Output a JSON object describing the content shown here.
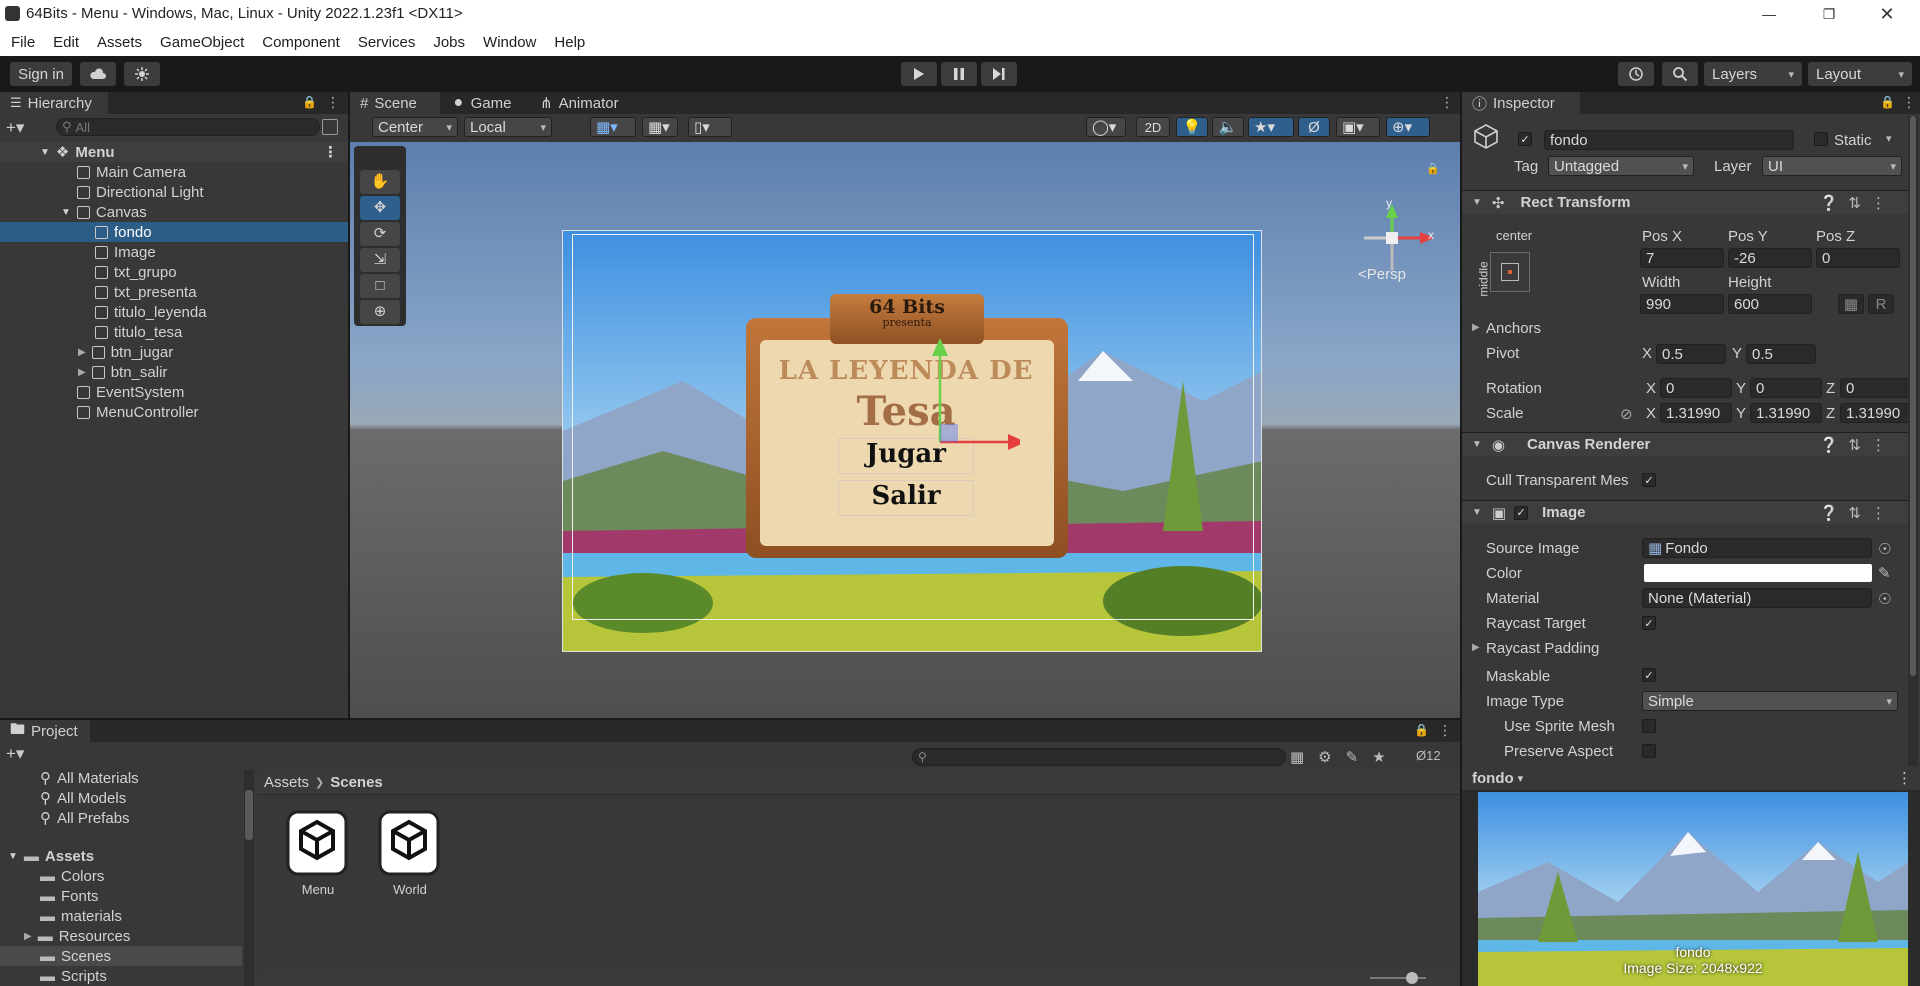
{
  "window": {
    "title": "64Bits - Menu - Windows, Mac, Linux - Unity 2022.1.23f1 <DX11>"
  },
  "menu": [
    "File",
    "Edit",
    "Assets",
    "GameObject",
    "Component",
    "Services",
    "Jobs",
    "Window",
    "Help"
  ],
  "toolbar": {
    "sign_in": "Sign in",
    "layers": "Layers",
    "layout": "Layout"
  },
  "hierarchy": {
    "tab": "Hierarchy",
    "search_placeholder": "All",
    "items": [
      {
        "label": "Menu",
        "depth": 0,
        "kind": "scene",
        "expanded": true
      },
      {
        "label": "Main Camera",
        "depth": 1
      },
      {
        "label": "Directional Light",
        "depth": 1
      },
      {
        "label": "Canvas",
        "depth": 1,
        "expanded": true
      },
      {
        "label": "fondo",
        "depth": 2,
        "selected": true
      },
      {
        "label": "Image",
        "depth": 2
      },
      {
        "label": "txt_grupo",
        "depth": 2
      },
      {
        "label": "txt_presenta",
        "depth": 2
      },
      {
        "label": "titulo_leyenda",
        "depth": 2
      },
      {
        "label": "titulo_tesa",
        "depth": 2
      },
      {
        "label": "btn_jugar",
        "depth": 2,
        "collapsed": true
      },
      {
        "label": "btn_salir",
        "depth": 2,
        "collapsed": true
      },
      {
        "label": "EventSystem",
        "depth": 1
      },
      {
        "label": "MenuController",
        "depth": 1
      }
    ]
  },
  "scene": {
    "tabs": [
      "Scene",
      "Game",
      "Animator"
    ],
    "pivot_mode": "Center",
    "pivot_space": "Local",
    "mode_2d": "2D",
    "persp": "<Persp",
    "gizmo_y": "y",
    "gizmo_x": "x",
    "sign": {
      "title": "64 Bits",
      "subtitle": "presenta",
      "line1": "LA LEYENDA DE",
      "line2": "Tesa",
      "btn1": "Jugar",
      "btn2": "Salir"
    }
  },
  "inspector": {
    "tab": "Inspector",
    "object_name": "fondo",
    "static_label": "Static",
    "tag_label": "Tag",
    "tag_value": "Untagged",
    "layer_label": "Layer",
    "layer_value": "UI",
    "rect": {
      "header": "Rect Transform",
      "anchor_h": "center",
      "anchor_v": "middle",
      "pos_x_label": "Pos X",
      "pos_y_label": "Pos Y",
      "pos_z_label": "Pos Z",
      "pos_x": "7",
      "pos_y": "-26",
      "pos_z": "0",
      "width_label": "Width",
      "height_label": "Height",
      "width": "990",
      "height": "600",
      "r_btn": "R",
      "anchors": "Anchors",
      "pivot": "Pivot",
      "pivot_x": "0.5",
      "pivot_y": "0.5",
      "rotation": "Rotation",
      "rot_x": "0",
      "rot_y": "0",
      "rot_z": "0",
      "scale": "Scale",
      "scale_x": "1.31990",
      "scale_y": "1.31990",
      "scale_z": "1.31990",
      "x": "X",
      "y": "Y",
      "z": "Z"
    },
    "canvas_renderer": {
      "header": "Canvas Renderer",
      "cull": "Cull Transparent Mes"
    },
    "image": {
      "header": "Image",
      "source_image_label": "Source Image",
      "source_image": "Fondo",
      "color_label": "Color",
      "material_label": "Material",
      "material": "None (Material)",
      "raycast_target": "Raycast Target",
      "raycast_padding": "Raycast Padding",
      "maskable": "Maskable",
      "image_type_label": "Image Type",
      "image_type": "Simple",
      "use_sprite_mesh": "Use Sprite Mesh",
      "preserve_aspect": "Preserve Aspect"
    },
    "preview": {
      "name": "fondo",
      "caption_name": "fondo",
      "caption_size": "Image Size: 2048x922"
    }
  },
  "project": {
    "tab": "Project",
    "hidden_count": "12",
    "favorites": [
      "All Materials",
      "All Models",
      "All Prefabs"
    ],
    "assets_root": "Assets",
    "folders": [
      "Colors",
      "Fonts",
      "materials",
      "Resources",
      "Scenes",
      "Scripts"
    ],
    "breadcrumb": [
      "Assets",
      "Scenes"
    ],
    "files": [
      "Menu",
      "World"
    ]
  }
}
